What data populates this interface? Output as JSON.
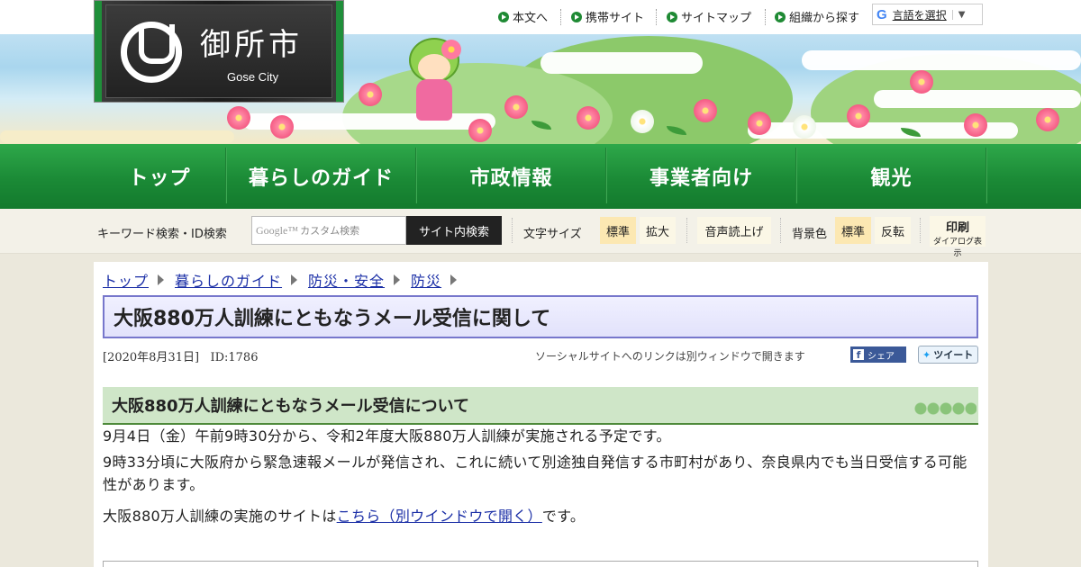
{
  "header": {
    "city_name": "御所市",
    "city_name_en": "Gose City",
    "util_links": [
      "本文へ",
      "携帯サイト",
      "サイトマップ",
      "組織から探す"
    ],
    "language": {
      "label": "言語を選択",
      "arrow": "▼"
    }
  },
  "nav": {
    "items": [
      "トップ",
      "暮らしのガイド",
      "市政情報",
      "事業者向け",
      "観光"
    ]
  },
  "toolbar": {
    "search_label": "キーワード検索・ID検索",
    "search_placeholder": "カスタム検索",
    "search_button": "サイト内検索",
    "font_size_label": "文字サイズ",
    "font_standard": "標準",
    "font_large": "拡大",
    "voice": "音声読上げ",
    "bg_label": "背景色",
    "bg_standard": "標準",
    "bg_invert": "反転",
    "print_label": "印刷",
    "print_sub": "ダイアログ表示"
  },
  "breadcrumb": [
    "トップ",
    "暮らしのガイド",
    "防災・安全",
    "防災"
  ],
  "article": {
    "title": "大阪880万人訓練にともなうメール受信に関して",
    "date": "[2020年8月31日]",
    "id": "ID:1786",
    "social_note": "ソーシャルサイトへのリンクは別ウィンドウで開きます",
    "share_label": "シェア",
    "tweet_label": "ツイート",
    "section_heading": "大阪880万人訓練にともなうメール受信について",
    "p1": "9月4日（金）午前9時30分から、令和2年度大阪880万人訓練が実施される予定です。",
    "p2": "9時33分頃に大阪府から緊急速報メールが発信され、これに続いて別途独自発信する市町村があり、奈良県内でも当日受信する可能性があります。",
    "p3_before": "大阪880万人訓練の実施のサイトは",
    "p3_link": "こちら（別ウインドウで開く）",
    "p3_after": "です。"
  },
  "colors": {
    "nav_green": "#1b8a36",
    "title_border": "#7777cc",
    "link": "#1a2ea6"
  }
}
